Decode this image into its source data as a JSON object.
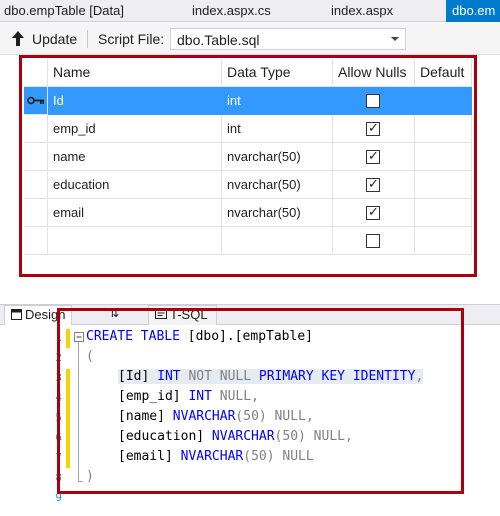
{
  "tabs": [
    {
      "label": "dbo.empTable [Data]"
    },
    {
      "label": "index.aspx.cs"
    },
    {
      "label": "index.aspx"
    },
    {
      "label": "dbo.em"
    }
  ],
  "toolbar": {
    "update_label": "Update",
    "script_file_label": "Script File:",
    "script_file_value": "dbo.Table.sql"
  },
  "grid": {
    "headers": [
      "Name",
      "Data Type",
      "Allow Nulls",
      "Default"
    ],
    "rows": [
      {
        "name": "Id",
        "type": "int",
        "allow_nulls": false
      },
      {
        "name": "emp_id",
        "type": "int",
        "allow_nulls": true
      },
      {
        "name": "name",
        "type": "nvarchar(50)",
        "allow_nulls": true
      },
      {
        "name": "education",
        "type": "nvarchar(50)",
        "allow_nulls": true
      },
      {
        "name": "email",
        "type": "nvarchar(50)",
        "allow_nulls": true
      },
      {
        "name": "",
        "type": "",
        "allow_nulls": false
      }
    ],
    "check_glyph": "✓"
  },
  "designer_tabs": {
    "design": "Design",
    "swap": "⇅",
    "tsql": "T-SQL"
  },
  "code": {
    "line_numbers": [
      "1",
      "2",
      "3",
      "4",
      "5",
      "6",
      "7",
      "8",
      "9"
    ],
    "l1_kw": "CREATE TABLE",
    "l1_rest": " [dbo].[empTable]",
    "l2": "(",
    "l3_id": "[Id]",
    "l3_int": " INT",
    "l3_notnull": " NOT NULL",
    "l3_pk": " PRIMARY KEY IDENTITY",
    "l3_comma": ",",
    "l4_col": "[emp_id]",
    "l4_int": " INT",
    "l4_null": " NULL",
    "l4_comma": ",",
    "l5_col": "[name]",
    "l5_type": " NVARCHAR",
    "l5_len": "(50)",
    "l5_null": " NULL",
    "l5_comma": ",",
    "l6_col": "[education]",
    "l6_type": " NVARCHAR",
    "l6_len": "(50)",
    "l6_null": " NULL",
    "l6_comma": ",",
    "l7_col": "[email]",
    "l7_type": " NVARCHAR",
    "l7_len": "(50)",
    "l7_null": " NULL",
    "l8": ")"
  },
  "colors": {
    "accent": "#007acc",
    "selection": "#3399ff",
    "highlight_box": "#a8000f",
    "keyword": "#0000ff",
    "change_marker": "#f5d500"
  }
}
